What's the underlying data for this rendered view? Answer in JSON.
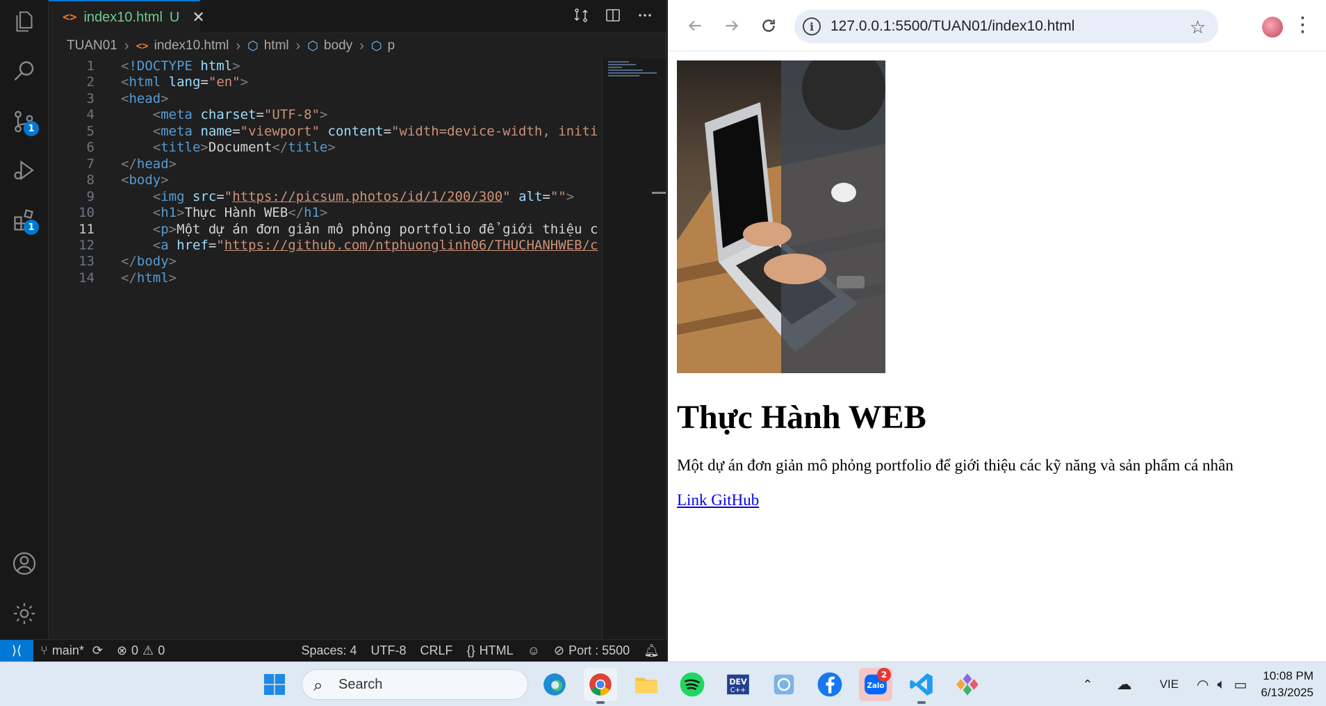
{
  "vscode": {
    "tab": {
      "icon": "<>",
      "filename": "index10.html",
      "status": "U"
    },
    "breadcrumb": [
      "TUAN01",
      "index10.html",
      "html",
      "body",
      "p"
    ],
    "code_lines": [
      {
        "n": "1",
        "html": "<span class='p'>&lt;</span><span class='t'>!DOCTYPE</span> <span class='a'>html</span><span class='p'>&gt;</span>"
      },
      {
        "n": "2",
        "html": "<span class='p'>&lt;</span><span class='t'>html</span> <span class='a'>lang</span><span class='txt'>=</span><span class='s'>\"en\"</span><span class='p'>&gt;</span>"
      },
      {
        "n": "3",
        "html": "<span class='p'>&lt;</span><span class='t'>head</span><span class='p'>&gt;</span>"
      },
      {
        "n": "4",
        "html": "    <span class='p'>&lt;</span><span class='t'>meta</span> <span class='a'>charset</span><span class='txt'>=</span><span class='s'>\"UTF-8\"</span><span class='p'>&gt;</span>"
      },
      {
        "n": "5",
        "html": "    <span class='p'>&lt;</span><span class='t'>meta</span> <span class='a'>name</span><span class='txt'>=</span><span class='s'>\"viewport\"</span> <span class='a'>content</span><span class='txt'>=</span><span class='s'>\"width=device-width, initi</span>"
      },
      {
        "n": "6",
        "html": "    <span class='p'>&lt;</span><span class='t'>title</span><span class='p'>&gt;</span><span class='txt'>Document</span><span class='p'>&lt;/</span><span class='t'>title</span><span class='p'>&gt;</span>"
      },
      {
        "n": "7",
        "html": "<span class='p'>&lt;/</span><span class='t'>head</span><span class='p'>&gt;</span>"
      },
      {
        "n": "8",
        "html": "<span class='p'>&lt;</span><span class='t'>body</span><span class='p'>&gt;</span>"
      },
      {
        "n": "9",
        "html": "    <span class='p'>&lt;</span><span class='t'>img</span> <span class='a'>src</span><span class='txt'>=</span><span class='s'>\"<span class='u'>https://picsum.photos/id/1/200/300</span>\"</span> <span class='a'>alt</span><span class='txt'>=</span><span class='s'>\"\"</span><span class='p'>&gt;</span>"
      },
      {
        "n": "10",
        "html": "    <span class='p'>&lt;</span><span class='t'>h1</span><span class='p'>&gt;</span><span class='txt'>Thực Hành WEB</span><span class='p'>&lt;/</span><span class='t'>h1</span><span class='p'>&gt;</span>"
      },
      {
        "n": "11",
        "html": "    <span class='p'>&lt;</span><span class='t'>p</span><span class='p'>&gt;</span><span class='txt'>Một dự án đơn giản mô phỏng portfolio để giới thiệu c</span>"
      },
      {
        "n": "12",
        "html": "    <span class='p'>&lt;</span><span class='t'>a</span> <span class='a'>href</span><span class='txt'>=</span><span class='s'>\"<span class='u'>https://github.com/ntphuonglinh06/THUCHANHWEB/c</span></span>"
      },
      {
        "n": "13",
        "html": "<span class='p'>&lt;/</span><span class='t'>body</span><span class='p'>&gt;</span>"
      },
      {
        "n": "14",
        "html": "<span class='p'>&lt;/</span><span class='t'>html</span><span class='p'>&gt;</span>"
      }
    ],
    "current_line": "11",
    "activity_badges": {
      "source_control": "1",
      "extensions": "1"
    },
    "status": {
      "branch": "main*",
      "errors": "0",
      "warnings": "0",
      "spaces": "Spaces: 4",
      "encoding": "UTF-8",
      "eol": "CRLF",
      "language": "HTML",
      "port": "Port : 5500"
    }
  },
  "browser": {
    "url": "127.0.0.1:5500/TUAN01/index10.html",
    "page": {
      "heading": "Thực Hành WEB",
      "paragraph": "Một dự án đơn giản mô phỏng portfolio để giới thiệu các kỹ năng và sản phẩm cá nhân",
      "link": "Link GitHub"
    }
  },
  "taskbar": {
    "search_placeholder": "Search",
    "zalo_badge": "2",
    "language": "VIE",
    "time": "10:08 PM",
    "date": "6/13/2025"
  }
}
